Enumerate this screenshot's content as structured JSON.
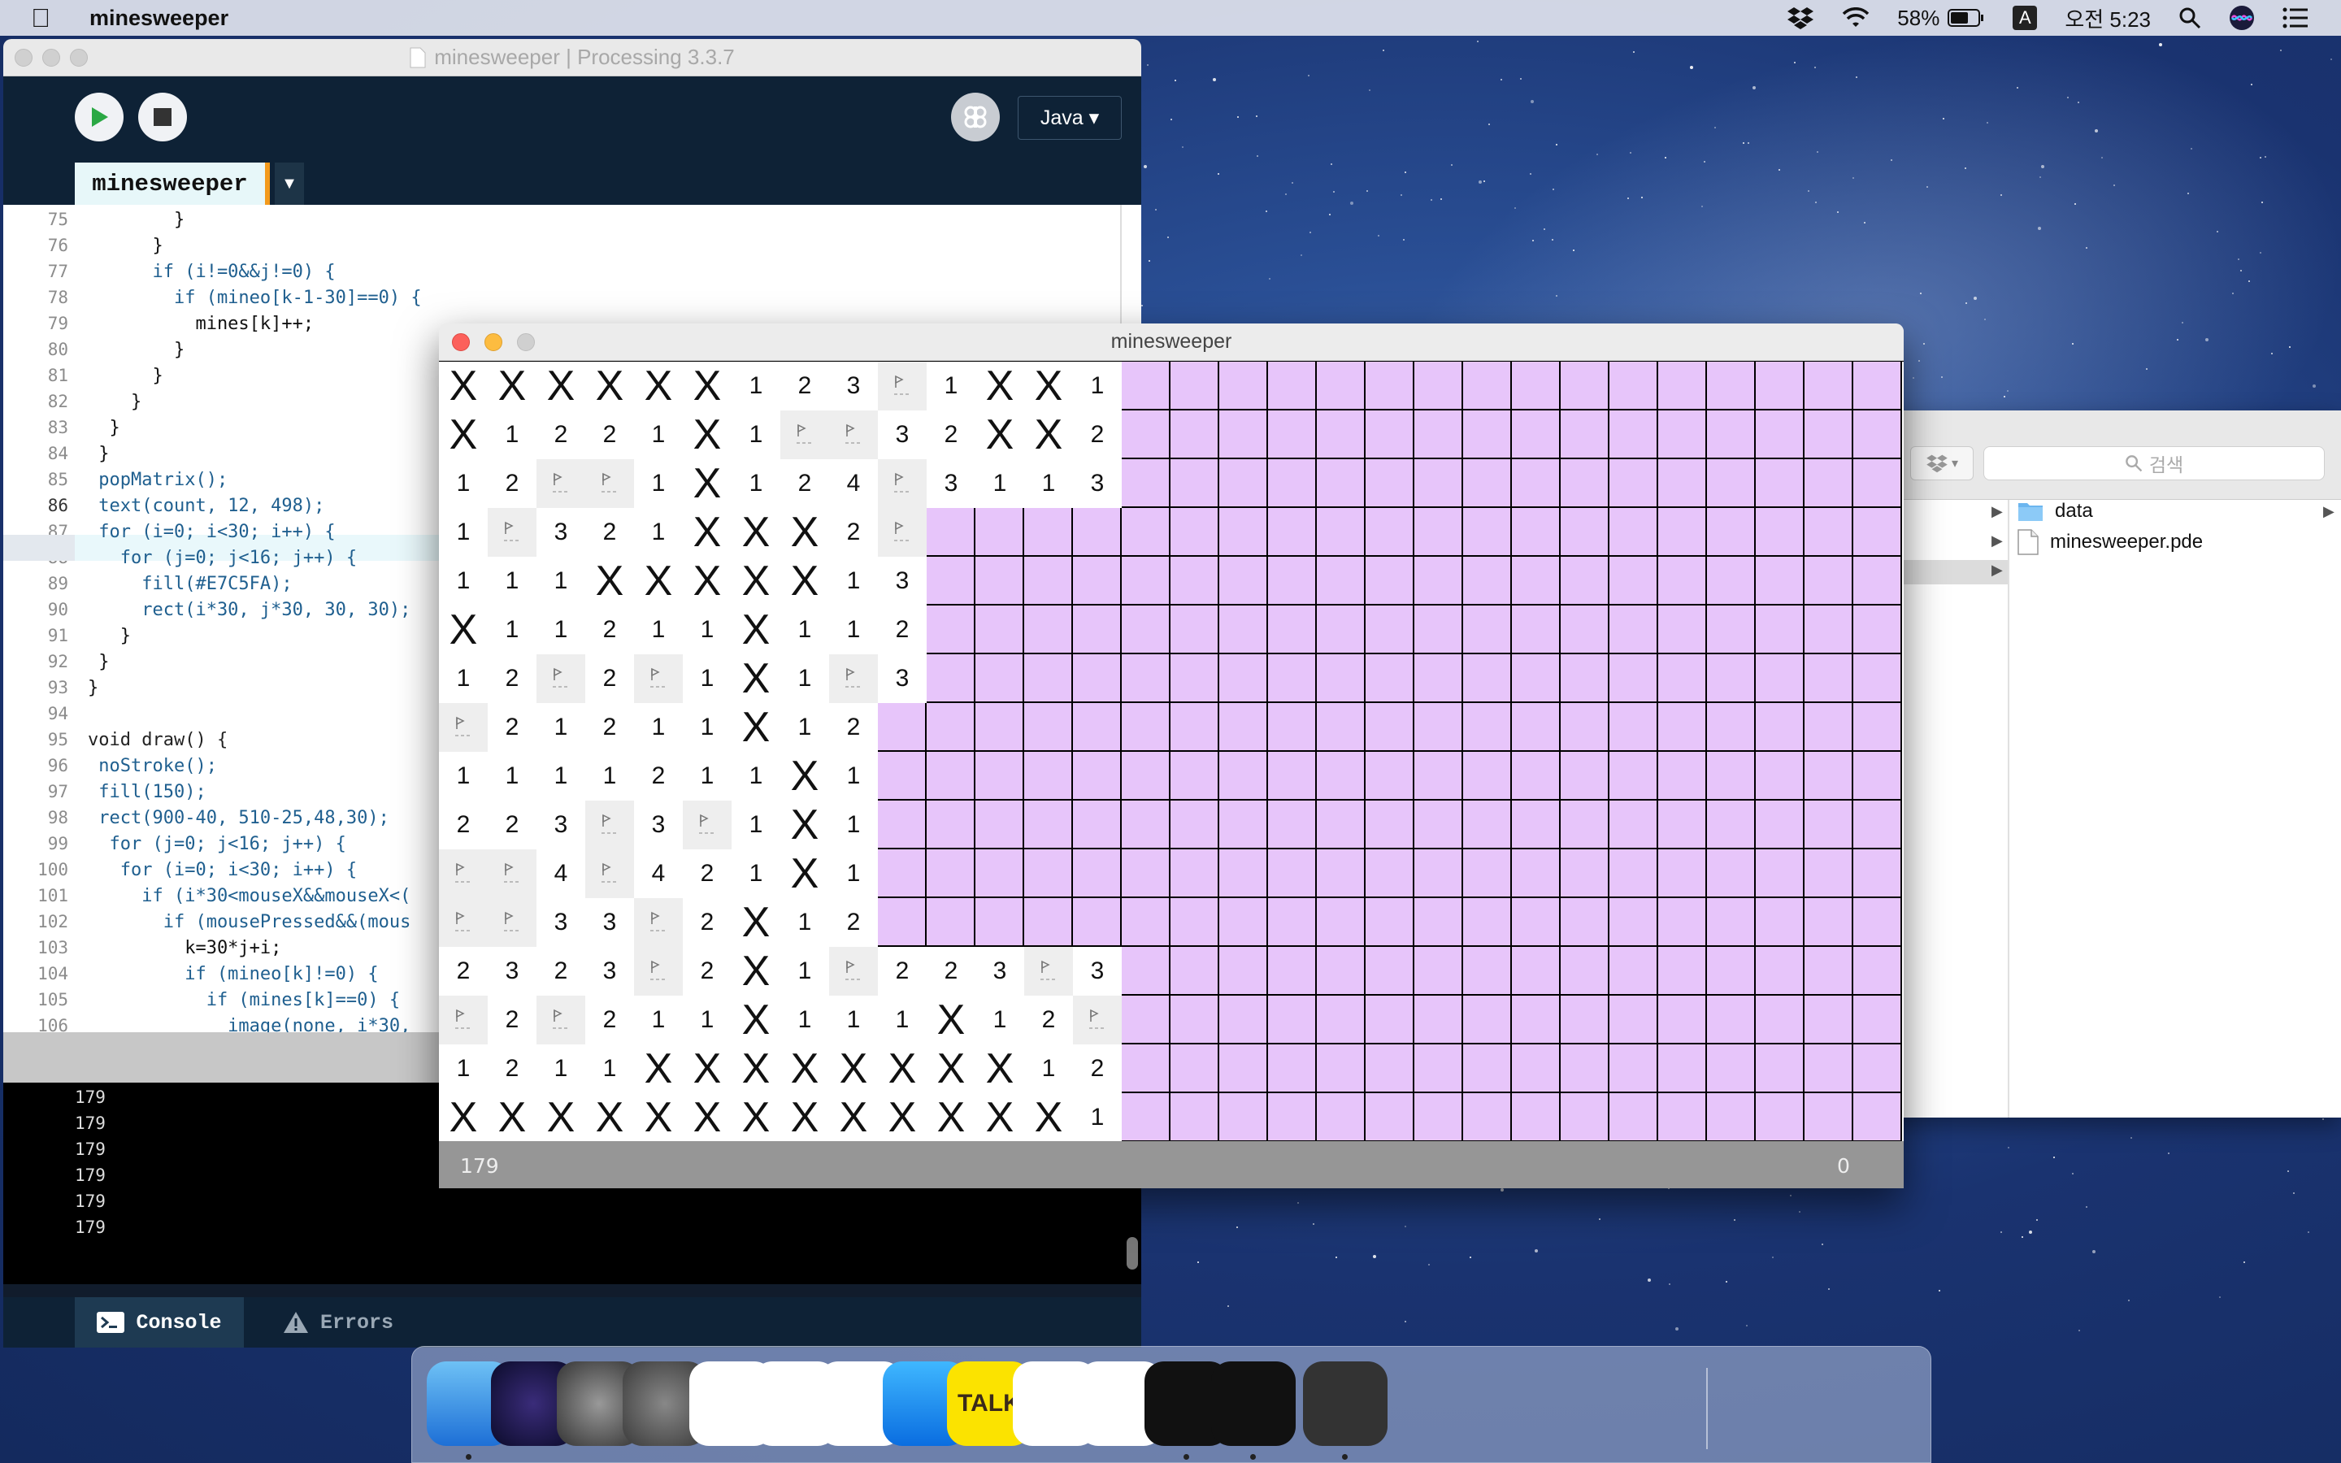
{
  "menubar": {
    "app_name": "minesweeper",
    "battery_percent": "58%",
    "input_source": "A",
    "clock": "오전 5:23"
  },
  "editor_window": {
    "title": "minesweeper | Processing 3.3.7",
    "mode": "Java ▾",
    "tab_label": "minesweeper",
    "code_lines": [
      {
        "n": "75",
        "text": "        }"
      },
      {
        "n": "76",
        "text": "      }"
      },
      {
        "n": "77",
        "text": "      if (i!=0&&j!=0) {"
      },
      {
        "n": "78",
        "text": "        if (mineo[k-1-30]==0) {"
      },
      {
        "n": "79",
        "text": "          mines[k]++;"
      },
      {
        "n": "80",
        "text": "        }"
      },
      {
        "n": "81",
        "text": "      }"
      },
      {
        "n": "82",
        "text": "    }"
      },
      {
        "n": "83",
        "text": "  }"
      },
      {
        "n": "84",
        "text": " }"
      },
      {
        "n": "85",
        "text": " popMatrix();"
      },
      {
        "n": "86",
        "text": " text(count, 12, 498);"
      },
      {
        "n": "87",
        "text": " for (i=0; i<30; i++) {"
      },
      {
        "n": "88",
        "text": "   for (j=0; j<16; j++) {"
      },
      {
        "n": "89",
        "text": "     fill(#E7C5FA);"
      },
      {
        "n": "90",
        "text": "     rect(i*30, j*30, 30, 30);"
      },
      {
        "n": "91",
        "text": "   }"
      },
      {
        "n": "92",
        "text": " }"
      },
      {
        "n": "93",
        "text": "}"
      },
      {
        "n": "94",
        "text": ""
      },
      {
        "n": "95",
        "text": "void draw() {"
      },
      {
        "n": "96",
        "text": " noStroke();"
      },
      {
        "n": "97",
        "text": " fill(150);"
      },
      {
        "n": "98",
        "text": " rect(900-40, 510-25,48,30);"
      },
      {
        "n": "99",
        "text": "  for (j=0; j<16; j++) {"
      },
      {
        "n": "100",
        "text": "   for (i=0; i<30; i++) {"
      },
      {
        "n": "101",
        "text": "     if (i*30<mouseX&&mouseX<("
      },
      {
        "n": "102",
        "text": "       if (mousePressed&&(mous"
      },
      {
        "n": "103",
        "text": "         k=30*j+i;"
      },
      {
        "n": "104",
        "text": "         if (mineo[k]!=0) {"
      },
      {
        "n": "105",
        "text": "           if (mines[k]==0) {"
      },
      {
        "n": "106",
        "text": "             image(none, i*30,"
      }
    ],
    "highlight_line": "86",
    "console_lines": [
      "179",
      "179",
      "179",
      "179",
      "179",
      "179"
    ],
    "console_tab": "Console",
    "errors_tab": "Errors"
  },
  "finder": {
    "search_placeholder": "검색",
    "items": [
      {
        "name": "data",
        "icon": "folder-icon"
      },
      {
        "name": "minesweeper.pde",
        "icon": "file-icon"
      }
    ]
  },
  "sketch_window": {
    "title": "minesweeper",
    "count": "179",
    "right_value": "0",
    "hidden_color": "#E7C5FA",
    "board": [
      "XXXXXX123F1XX1",
      "X1221X1FF32XX2",
      "12FF1X124F3113",
      "1F321XXX2F",
      "111XXXXX13",
      "X11211X112",
      "12F2F1X1F3",
      "F21211X12",
      "1111211X1",
      "223F3F1X1",
      "FF4F421X1",
      "FF33F2X12",
      "2323F2X1F223F3",
      "F2F211X111X12F",
      "1211XXXXXXXX12",
      "XXXXXXXXXXXXX1"
    ]
  },
  "dock": {
    "apps": [
      {
        "name": "finder-icon"
      },
      {
        "name": "siri-icon"
      },
      {
        "name": "system-preferences-icon"
      },
      {
        "name": "launchpad-icon"
      },
      {
        "name": "reminders-icon"
      },
      {
        "name": "photos-icon"
      },
      {
        "name": "music-icon"
      },
      {
        "name": "app-store-icon"
      },
      {
        "name": "kakaotalk-icon",
        "label": "TALK"
      },
      {
        "name": "youtube-player-icon"
      },
      {
        "name": "chrome-icon"
      },
      {
        "name": "processing-icon"
      },
      {
        "name": "quicktime-icon"
      },
      {
        "name": "processing-window-thumb-icon"
      },
      {
        "name": "trash-icon"
      }
    ]
  }
}
